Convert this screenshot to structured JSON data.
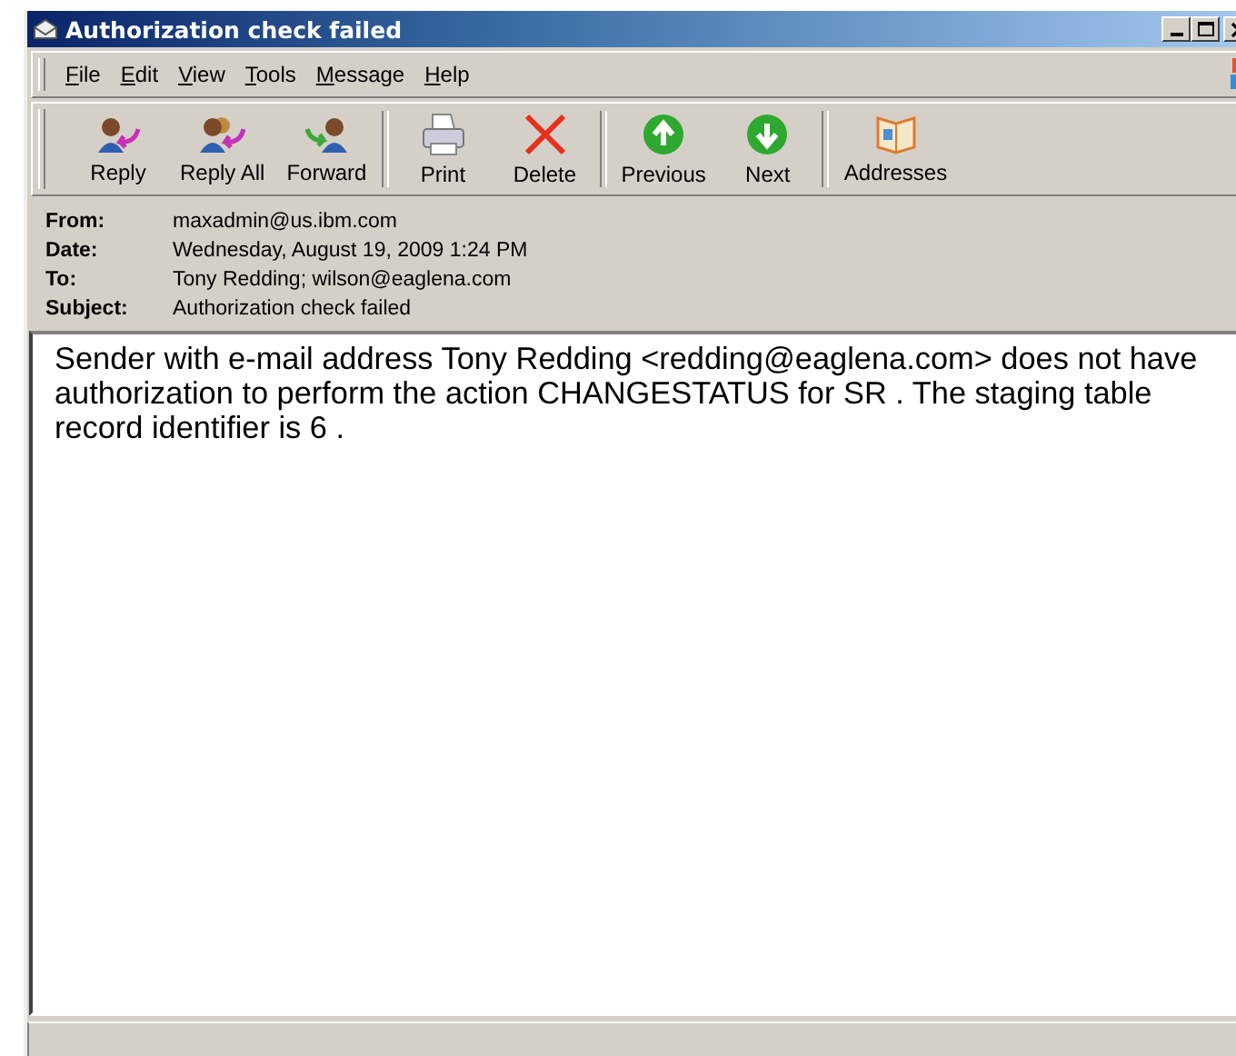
{
  "window": {
    "title": "Authorization check failed"
  },
  "menu": [
    {
      "label": "File"
    },
    {
      "label": "Edit"
    },
    {
      "label": "View"
    },
    {
      "label": "Tools"
    },
    {
      "label": "Message"
    },
    {
      "label": "Help"
    }
  ],
  "toolbar": [
    {
      "kind": "reply",
      "label": "Reply"
    },
    {
      "kind": "reply-all",
      "label": "Reply All"
    },
    {
      "kind": "forward",
      "label": "Forward"
    },
    {
      "kind": "separator"
    },
    {
      "kind": "print",
      "label": "Print"
    },
    {
      "kind": "delete",
      "label": "Delete"
    },
    {
      "kind": "separator"
    },
    {
      "kind": "previous",
      "label": "Previous"
    },
    {
      "kind": "next",
      "label": "Next"
    },
    {
      "kind": "separator"
    },
    {
      "kind": "addresses",
      "label": "Addresses"
    }
  ],
  "headers": [
    {
      "label": "From:",
      "value": "maxadmin@us.ibm.com"
    },
    {
      "label": "Date:",
      "value": "Wednesday, August 19, 2009 1:24 PM"
    },
    {
      "label": "To:",
      "value": "Tony Redding; wilson@eaglena.com"
    },
    {
      "label": "Subject:",
      "value": "Authorization check failed"
    }
  ],
  "body": "Sender with e-mail address Tony Redding <redding@eaglena.com> does not have authorization to perform the action CHANGESTATUS for SR . The staging table record identifier is 6 ."
}
